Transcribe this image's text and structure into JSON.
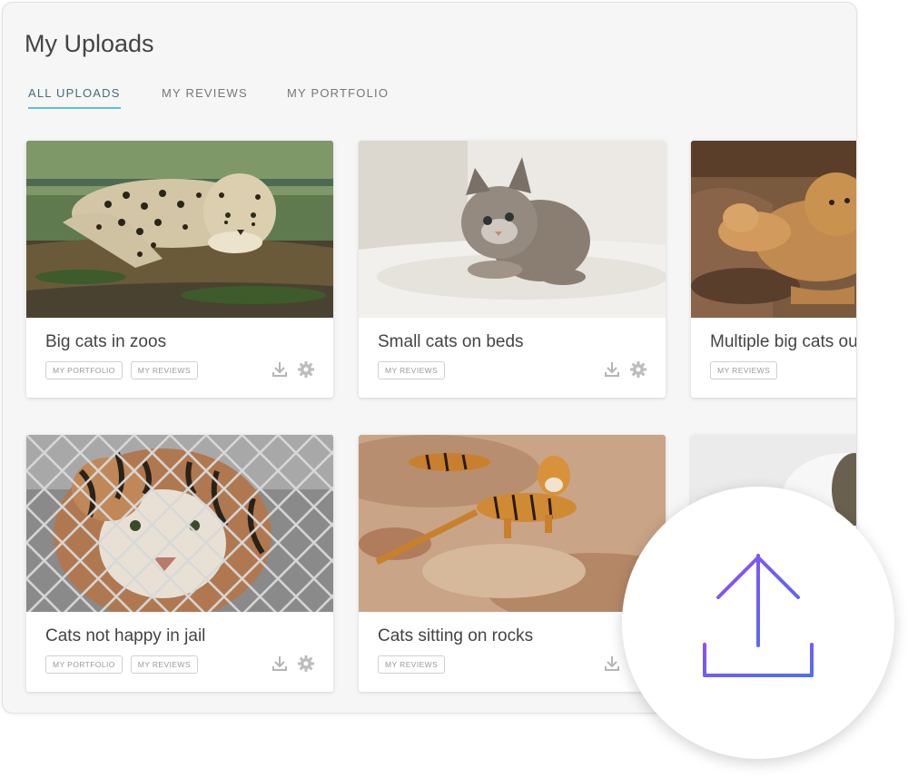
{
  "page": {
    "title": "My Uploads"
  },
  "tabs": [
    {
      "label": "ALL UPLOADS",
      "active": true
    },
    {
      "label": "MY REVIEWS",
      "active": false
    },
    {
      "label": "MY PORTFOLIO",
      "active": false
    }
  ],
  "cards": [
    {
      "title": "Big cats in zoos",
      "tags": [
        "MY PORTFOLIO",
        "MY REVIEWS"
      ],
      "image": "leopard-on-log"
    },
    {
      "title": "Small cats on beds",
      "tags": [
        "MY REVIEWS"
      ],
      "image": "kitten-on-bed"
    },
    {
      "title": "Multiple big cats ou",
      "tags": [
        "MY REVIEWS"
      ],
      "image": "lions-on-rocks"
    },
    {
      "title": "Cats not happy in jail",
      "tags": [
        "MY PORTFOLIO",
        "MY REVIEWS"
      ],
      "image": "tiger-behind-fence"
    },
    {
      "title": "Cats sitting on rocks",
      "tags": [
        "MY REVIEWS"
      ],
      "image": "tigers-on-rocks"
    }
  ],
  "icons": {
    "download": "download-icon",
    "settings": "gear-icon",
    "upload": "upload-icon"
  },
  "colors": {
    "tab_active_underline": "#5bc0de",
    "upload_gradient_start": "#8f4ff0",
    "upload_gradient_end": "#4f6ff0"
  }
}
